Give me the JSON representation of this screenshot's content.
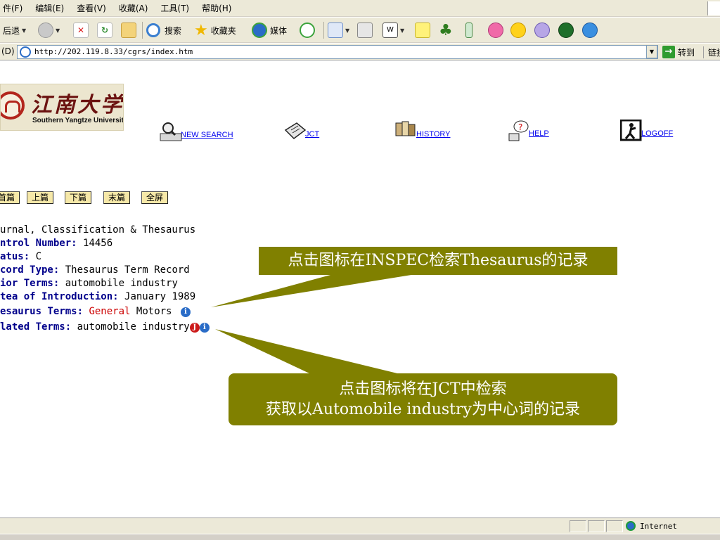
{
  "menu": [
    "件(F)",
    "编辑(E)",
    "查看(V)",
    "收藏(A)",
    "工具(T)",
    "帮助(H)"
  ],
  "toolbar": {
    "back_label": "后退",
    "search_label": "搜索",
    "favorites_label": "收藏夹",
    "media_label": "媒体"
  },
  "address": {
    "label": "(D)",
    "url": "http://202.119.8.33/cgrs/index.htm",
    "go_label": "转到",
    "links_label": "链接"
  },
  "logo": {
    "cn": "江南大学",
    "en": "Southern Yangtze University"
  },
  "nav": [
    {
      "label": "NEW SEARCH",
      "icon": "magnifier-icon"
    },
    {
      "label": "JCT",
      "icon": "journal-icon"
    },
    {
      "label": "HISTORY",
      "icon": "books-icon"
    },
    {
      "label": "HELP",
      "icon": "help-icon"
    },
    {
      "label": "LOGOFF",
      "icon": "exit-icon"
    }
  ],
  "pager": [
    "首篇",
    "上篇",
    "下篇",
    "末篇",
    "全屏"
  ],
  "record": {
    "title": "urnal, Classification & Thesaurus",
    "control_key": "ntrol Number:",
    "control_val": "14456",
    "status_key": "atus:",
    "status_val": "C",
    "type_key": "cord Type:",
    "type_val": "Thesaurus Term Record",
    "prior_key": "ior Terms:",
    "prior_val": "automobile industry",
    "date_key": "tea of Introduction:",
    "date_val": "January 1989",
    "thes_key": "esaurus Terms:",
    "thes_val_red": "General",
    "thes_val": "Motors",
    "related_key": "lated Terms:",
    "related_val": "automobile industry"
  },
  "callouts": {
    "inspec": "点击图标在INSPEC检索Thesaurus的记录",
    "jct_line1": "点击图标将在JCT中检索",
    "jct_line2": "获取以Automobile industry为中心词的记录"
  },
  "status": {
    "zone": "Internet"
  },
  "colors": {
    "callout_bg": "#808000",
    "link": "#0000ee",
    "key_text": "#00008b",
    "highlight": "#cc0000"
  }
}
